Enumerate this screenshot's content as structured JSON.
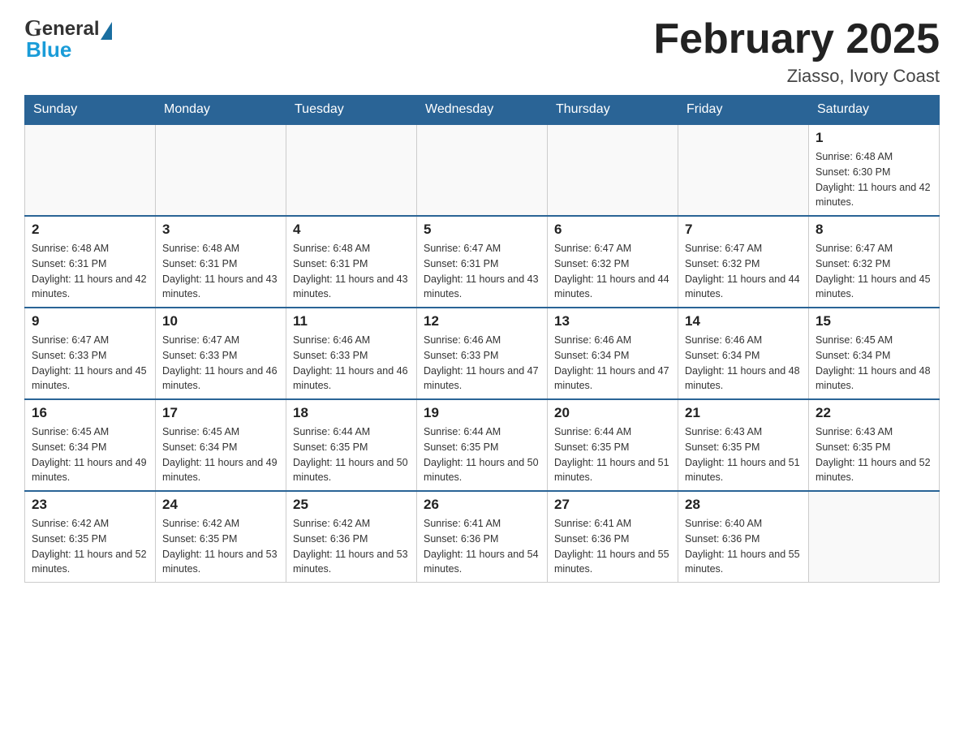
{
  "header": {
    "title": "February 2025",
    "location": "Ziasso, Ivory Coast"
  },
  "logo": {
    "general": "General",
    "blue": "Blue"
  },
  "days_of_week": [
    "Sunday",
    "Monday",
    "Tuesday",
    "Wednesday",
    "Thursday",
    "Friday",
    "Saturday"
  ],
  "weeks": [
    {
      "days": [
        {
          "number": "",
          "info": ""
        },
        {
          "number": "",
          "info": ""
        },
        {
          "number": "",
          "info": ""
        },
        {
          "number": "",
          "info": ""
        },
        {
          "number": "",
          "info": ""
        },
        {
          "number": "",
          "info": ""
        },
        {
          "number": "1",
          "info": "Sunrise: 6:48 AM\nSunset: 6:30 PM\nDaylight: 11 hours and 42 minutes."
        }
      ]
    },
    {
      "days": [
        {
          "number": "2",
          "info": "Sunrise: 6:48 AM\nSunset: 6:31 PM\nDaylight: 11 hours and 42 minutes."
        },
        {
          "number": "3",
          "info": "Sunrise: 6:48 AM\nSunset: 6:31 PM\nDaylight: 11 hours and 43 minutes."
        },
        {
          "number": "4",
          "info": "Sunrise: 6:48 AM\nSunset: 6:31 PM\nDaylight: 11 hours and 43 minutes."
        },
        {
          "number": "5",
          "info": "Sunrise: 6:47 AM\nSunset: 6:31 PM\nDaylight: 11 hours and 43 minutes."
        },
        {
          "number": "6",
          "info": "Sunrise: 6:47 AM\nSunset: 6:32 PM\nDaylight: 11 hours and 44 minutes."
        },
        {
          "number": "7",
          "info": "Sunrise: 6:47 AM\nSunset: 6:32 PM\nDaylight: 11 hours and 44 minutes."
        },
        {
          "number": "8",
          "info": "Sunrise: 6:47 AM\nSunset: 6:32 PM\nDaylight: 11 hours and 45 minutes."
        }
      ]
    },
    {
      "days": [
        {
          "number": "9",
          "info": "Sunrise: 6:47 AM\nSunset: 6:33 PM\nDaylight: 11 hours and 45 minutes."
        },
        {
          "number": "10",
          "info": "Sunrise: 6:47 AM\nSunset: 6:33 PM\nDaylight: 11 hours and 46 minutes."
        },
        {
          "number": "11",
          "info": "Sunrise: 6:46 AM\nSunset: 6:33 PM\nDaylight: 11 hours and 46 minutes."
        },
        {
          "number": "12",
          "info": "Sunrise: 6:46 AM\nSunset: 6:33 PM\nDaylight: 11 hours and 47 minutes."
        },
        {
          "number": "13",
          "info": "Sunrise: 6:46 AM\nSunset: 6:34 PM\nDaylight: 11 hours and 47 minutes."
        },
        {
          "number": "14",
          "info": "Sunrise: 6:46 AM\nSunset: 6:34 PM\nDaylight: 11 hours and 48 minutes."
        },
        {
          "number": "15",
          "info": "Sunrise: 6:45 AM\nSunset: 6:34 PM\nDaylight: 11 hours and 48 minutes."
        }
      ]
    },
    {
      "days": [
        {
          "number": "16",
          "info": "Sunrise: 6:45 AM\nSunset: 6:34 PM\nDaylight: 11 hours and 49 minutes."
        },
        {
          "number": "17",
          "info": "Sunrise: 6:45 AM\nSunset: 6:34 PM\nDaylight: 11 hours and 49 minutes."
        },
        {
          "number": "18",
          "info": "Sunrise: 6:44 AM\nSunset: 6:35 PM\nDaylight: 11 hours and 50 minutes."
        },
        {
          "number": "19",
          "info": "Sunrise: 6:44 AM\nSunset: 6:35 PM\nDaylight: 11 hours and 50 minutes."
        },
        {
          "number": "20",
          "info": "Sunrise: 6:44 AM\nSunset: 6:35 PM\nDaylight: 11 hours and 51 minutes."
        },
        {
          "number": "21",
          "info": "Sunrise: 6:43 AM\nSunset: 6:35 PM\nDaylight: 11 hours and 51 minutes."
        },
        {
          "number": "22",
          "info": "Sunrise: 6:43 AM\nSunset: 6:35 PM\nDaylight: 11 hours and 52 minutes."
        }
      ]
    },
    {
      "days": [
        {
          "number": "23",
          "info": "Sunrise: 6:42 AM\nSunset: 6:35 PM\nDaylight: 11 hours and 52 minutes."
        },
        {
          "number": "24",
          "info": "Sunrise: 6:42 AM\nSunset: 6:35 PM\nDaylight: 11 hours and 53 minutes."
        },
        {
          "number": "25",
          "info": "Sunrise: 6:42 AM\nSunset: 6:36 PM\nDaylight: 11 hours and 53 minutes."
        },
        {
          "number": "26",
          "info": "Sunrise: 6:41 AM\nSunset: 6:36 PM\nDaylight: 11 hours and 54 minutes."
        },
        {
          "number": "27",
          "info": "Sunrise: 6:41 AM\nSunset: 6:36 PM\nDaylight: 11 hours and 55 minutes."
        },
        {
          "number": "28",
          "info": "Sunrise: 6:40 AM\nSunset: 6:36 PM\nDaylight: 11 hours and 55 minutes."
        },
        {
          "number": "",
          "info": ""
        }
      ]
    }
  ]
}
